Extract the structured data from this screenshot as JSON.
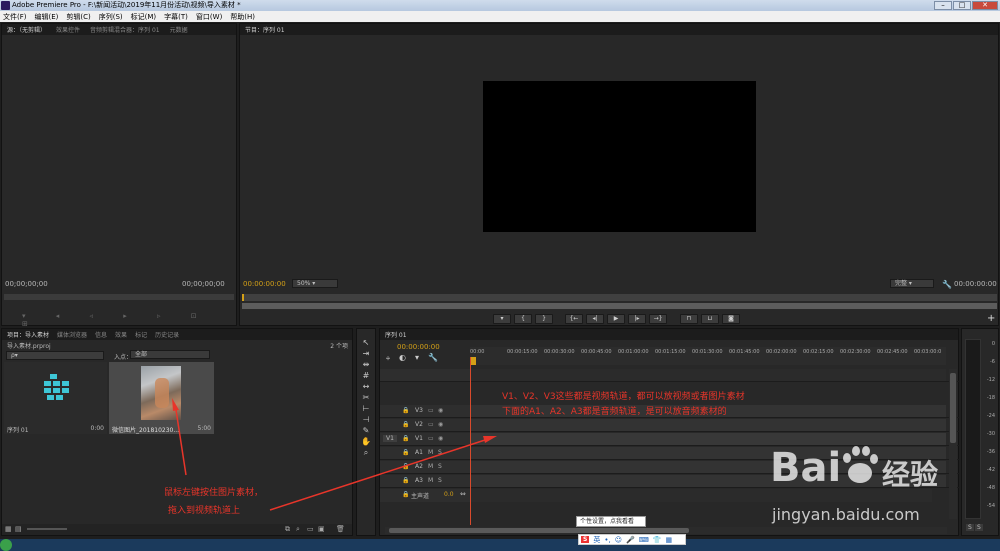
{
  "window": {
    "title": "Adobe Premiere Pro - F:\\新闻活动\\2019年11月份活动\\视频\\导入素材 *",
    "buttons": [
      "–",
      "□",
      "✕"
    ]
  },
  "menu": [
    "文件(F)",
    "编辑(E)",
    "剪辑(C)",
    "序列(S)",
    "标记(M)",
    "字幕(T)",
    "窗口(W)",
    "帮助(H)"
  ],
  "source_panel": {
    "tabs": [
      "源：（无剪辑）",
      "效果控件",
      "音频剪辑混合器：序列 01",
      "元数据"
    ],
    "left_timecode": "00;00;00;00",
    "right_timecode": "00;00;00;00"
  },
  "program_panel": {
    "tab": "节目：序列 01",
    "timecode": "00:00:00:00",
    "zoom": "50%",
    "quality": "完整",
    "duration": "00:00:00:00"
  },
  "project_panel": {
    "tabs": [
      "项目：导入素材",
      "媒体浏览器",
      "信息",
      "效果",
      "标记",
      "历史记录"
    ],
    "item_count": "2 个项",
    "project_file": "导入素材.prproj",
    "search_placeholder": "ρ▾",
    "in_label": "入点：",
    "in_value": "全部",
    "items": [
      {
        "name": "序列 01",
        "duration": "0:00"
      },
      {
        "name": "微信图片_201810230...",
        "duration": "5:00"
      }
    ]
  },
  "timeline_panel": {
    "tab": "序列 01",
    "timecode": "00:00:00:00",
    "ruler": [
      "00:00",
      "00:00:15:00",
      "00:00:30:00",
      "00:00:45:00",
      "00:01:00:00",
      "00:01:15:00",
      "00:01:30:00",
      "00:01:45:00",
      "00:02:00:00",
      "00:02:15:00",
      "00:02:30:00",
      "00:02:45:00",
      "00:03:00:0"
    ],
    "source_label": "V1",
    "video_tracks": [
      "V3",
      "V2",
      "V1"
    ],
    "audio_tracks": [
      "A1",
      "A2",
      "A3"
    ],
    "master_label": "主声道",
    "master_value": "0.0",
    "m_label": "M",
    "s_label": "S"
  },
  "meter": {
    "ticks": [
      "0",
      "-6",
      "-12",
      "-18",
      "-24",
      "-30",
      "-36",
      "-42",
      "-48",
      "-54"
    ],
    "solo": "S",
    "solo2": "S"
  },
  "annotations": {
    "a1_line1": "V1、V2、V3这些都是视频轨道，都可以放视频或者图片素材",
    "a1_line2": "下面的A1、A2、A3都是音频轨道，是可以放音频素材的",
    "a2_line1": "鼠标左键按住图片素材，",
    "a2_line2": "拖入到视频轨道上"
  },
  "watermark": {
    "brand": "Bai",
    "brand2": "经验",
    "url": "jingyan.baidu.com"
  },
  "ime": {
    "tooltip": "个性设置，点我看看",
    "lang": "英"
  }
}
